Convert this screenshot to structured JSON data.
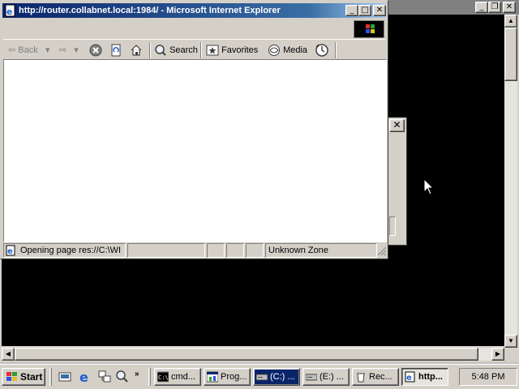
{
  "ie_window": {
    "title": "http://router.collabnet.local:1984/ - Microsoft Internet Explorer",
    "toolbar": {
      "back": "Back",
      "search": "Search",
      "favorites": "Favorites",
      "media": "Media"
    },
    "status": {
      "message": "Opening page res://C:\\WI",
      "zone": "Unknown Zone"
    }
  },
  "taskbar": {
    "start_label": "Start",
    "tasks": [
      {
        "label": "cmd..."
      },
      {
        "label": "Prog..."
      },
      {
        "label": "(C:) ..."
      },
      {
        "label": "(E:) ..."
      },
      {
        "label": "Rec..."
      },
      {
        "label": "http..."
      }
    ],
    "clock": "5:48 PM"
  },
  "colors": {
    "active_title": "#0a246a",
    "inactive_title": "#808080",
    "console_bg": "#000000",
    "face": "#d4d0c8"
  }
}
